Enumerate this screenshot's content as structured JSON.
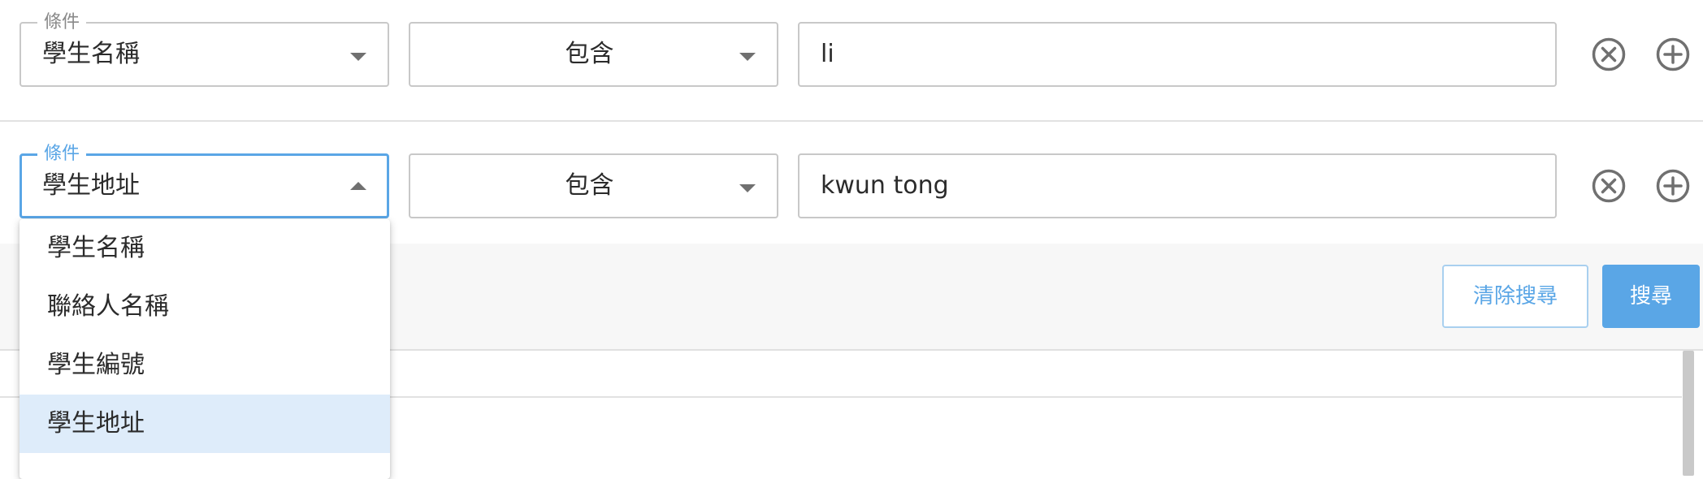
{
  "colors": {
    "accent": "#5aa6e6",
    "border": "#c8c8c8",
    "selected_bg": "#deecfa",
    "icon_gray": "#707070"
  },
  "rows": [
    {
      "field_legend": "條件",
      "field_value": "學生名稱",
      "operator_value": "包含",
      "text_value": "li",
      "remove_icon": "circle-x-icon",
      "add_icon": "circle-plus-icon"
    },
    {
      "field_legend": "條件",
      "field_value": "學生地址",
      "operator_value": "包含",
      "text_value": "kwun tong",
      "remove_icon": "circle-x-icon",
      "add_icon": "circle-plus-icon"
    }
  ],
  "actions": {
    "clear_label": "清除搜尋",
    "search_label": "搜尋"
  },
  "dropdown": {
    "options": [
      "學生名稱",
      "聯絡人名稱",
      "學生編號",
      "學生地址"
    ],
    "selected": "學生地址"
  }
}
